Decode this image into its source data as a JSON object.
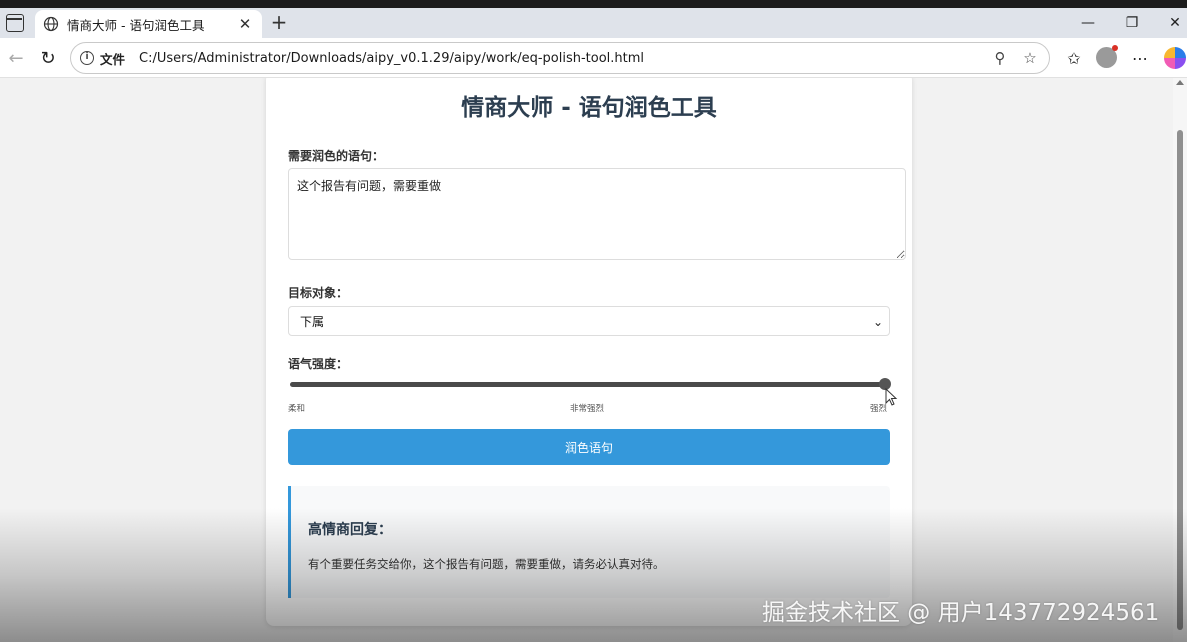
{
  "browser": {
    "tab_title": "情商大师 - 语句润色工具",
    "new_tab_symbol": "+",
    "close_symbol": "✕",
    "file_label": "文件",
    "url": "C:/Users/Administrator/Downloads/aipy_v0.1.29/aipy/work/eq-polish-tool.html",
    "icons": [
      "tab-actions-icon",
      "globe-icon",
      "back-icon",
      "reload-icon",
      "info-icon",
      "zoom-icon",
      "favorite-star-icon",
      "favorites-icon",
      "profile-avatar",
      "more-icon",
      "copilot-icon",
      "minimize-icon",
      "restore-icon",
      "close-window-icon"
    ]
  },
  "app": {
    "title": "情商大师 - 语句润色工具",
    "sentence_label": "需要润色的语句：",
    "sentence_value": "这个报告有问题，需要重做",
    "target_label": "目标对象：",
    "target_selected": "下属",
    "tone_label": "语气强度：",
    "tone_value": 1.0,
    "tone_labels": {
      "min": "柔和",
      "mid": "非常强烈",
      "max": "强烈"
    },
    "polish_button": "润色语句",
    "result_title": "高情商回复：",
    "result_text": "有个重要任务交给你，这个报告有问题，需要重做，请务必认真对待。",
    "accent_color": "#3498db",
    "title_color": "#2c3e50"
  },
  "overlay": {
    "watermark": "掘金技术社区 @ 用户143772924561"
  }
}
